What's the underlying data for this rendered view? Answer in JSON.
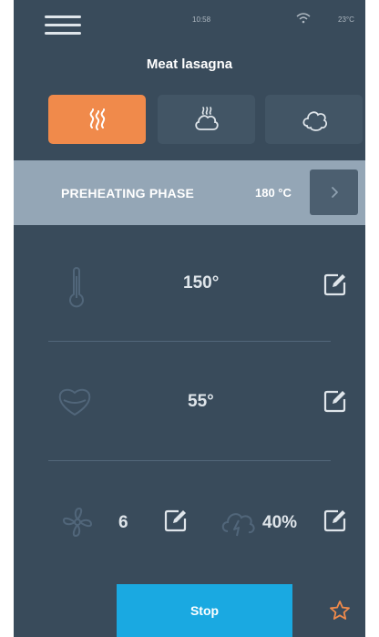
{
  "status_bar": {
    "time": "10:58",
    "temperature": "23°C",
    "menu_icon": "hamburger-menu-icon",
    "wifi_icon": "wifi-icon"
  },
  "title": "Meat lasagna",
  "modes": [
    {
      "icon": "convection-heat-icon",
      "active": true
    },
    {
      "icon": "steam-pot-icon",
      "active": false
    },
    {
      "icon": "steam-cloud-icon",
      "active": false
    }
  ],
  "preheat": {
    "label": "PREHEATING PHASE",
    "value": "180 °C",
    "next_icon": "chevron-right-icon"
  },
  "settings": {
    "oven_temperature": {
      "icon": "thermometer-icon",
      "value": "150°",
      "edit_icon": "edit-icon"
    },
    "core_temperature": {
      "icon": "core-probe-icon",
      "value": "55°",
      "edit_icon": "edit-icon"
    },
    "fan_speed": {
      "icon": "fan-icon",
      "value": "6",
      "edit_icon": "edit-icon"
    },
    "humidity": {
      "icon": "humidity-cloud-icon",
      "value": "40%",
      "edit_icon": "edit-icon"
    }
  },
  "footer": {
    "stop_label": "Stop",
    "favorite_icon": "star-icon"
  },
  "colors": {
    "background": "#394b5b",
    "accent_orange": "#f08a4b",
    "banner": "#94a6b6",
    "stop_blue": "#1aa9e1"
  }
}
